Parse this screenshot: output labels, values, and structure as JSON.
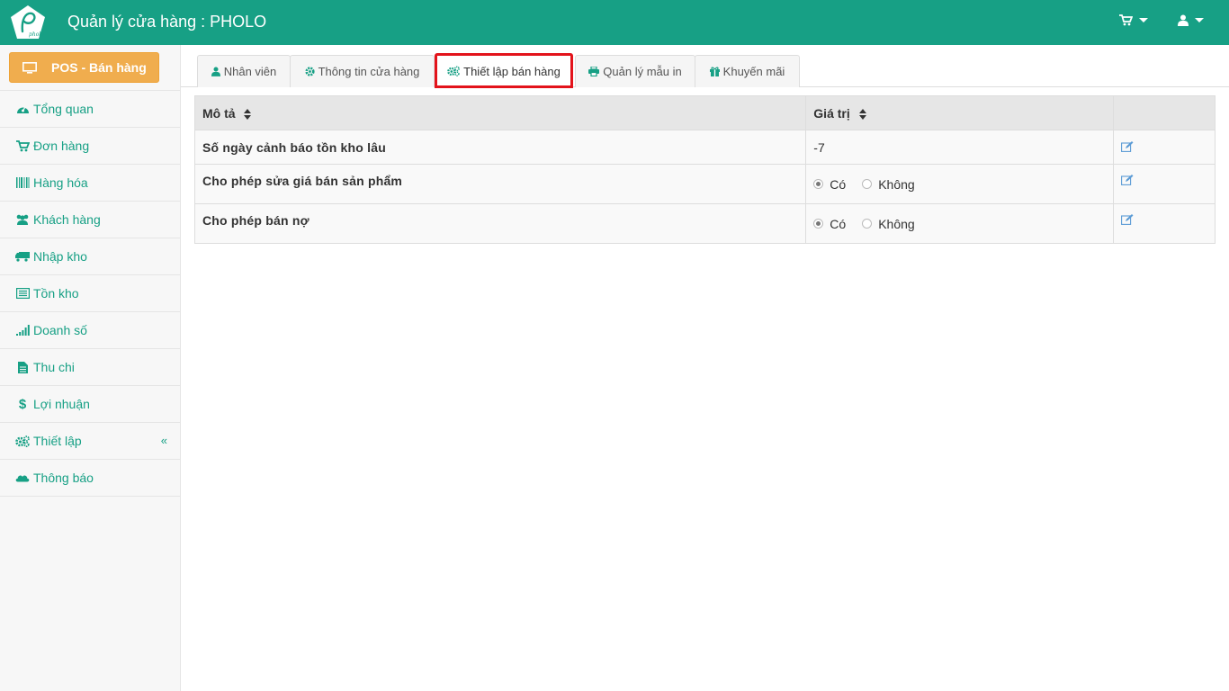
{
  "header": {
    "title": "Quản lý cửa hàng : PHOLO",
    "logo_text": "pholo",
    "cart_icon": "cart-icon",
    "user_icon": "user-icon"
  },
  "sidebar": {
    "pos_button": "POS - Bán hàng",
    "items": [
      {
        "label": "Tổng quan",
        "icon": "dashboard-icon"
      },
      {
        "label": "Đơn hàng",
        "icon": "cart-icon"
      },
      {
        "label": "Hàng hóa",
        "icon": "barcode-icon"
      },
      {
        "label": "Khách hàng",
        "icon": "users-icon"
      },
      {
        "label": "Nhập kho",
        "icon": "truck-icon"
      },
      {
        "label": "Tồn kho",
        "icon": "list-icon"
      },
      {
        "label": "Doanh số",
        "icon": "signal-icon"
      },
      {
        "label": "Thu chi",
        "icon": "file-icon"
      },
      {
        "label": "Lợi nhuận",
        "icon": "dollar-icon"
      },
      {
        "label": "Thiết lập",
        "icon": "cogs-icon"
      },
      {
        "label": "Thông báo",
        "icon": "cloud-icon"
      }
    ]
  },
  "tabs": [
    {
      "label": "Nhân viên",
      "icon": "user-icon"
    },
    {
      "label": "Thông tin cửa hàng",
      "icon": "cog-icon"
    },
    {
      "label": "Thiết lập bán hàng",
      "icon": "cogs-icon"
    },
    {
      "label": "Quản lý mẫu in",
      "icon": "print-icon"
    },
    {
      "label": "Khuyến mãi",
      "icon": "gift-icon"
    }
  ],
  "table": {
    "columns": [
      "Mô tả",
      "Giá trị"
    ],
    "rows": [
      {
        "desc": "Số ngày cảnh báo tồn kho lâu",
        "value": "-7"
      },
      {
        "desc": "Cho phép sửa giá bán sản phẩm",
        "opt_yes": "Có",
        "opt_no": "Không",
        "selected": "yes"
      },
      {
        "desc": "Cho phép bán nợ",
        "opt_yes": "Có",
        "opt_no": "Không",
        "selected": "yes"
      }
    ]
  },
  "colors": {
    "brand": "#17a085",
    "pos": "#f0ad4e",
    "highlight": "#e3131b"
  }
}
